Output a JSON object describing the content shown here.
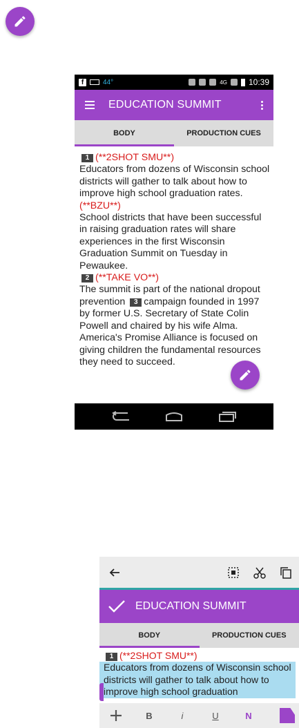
{
  "phone1": {
    "status": {
      "fb": "f",
      "temp": "44°",
      "network": "4G",
      "time": "10:39"
    },
    "title": "EDUCATION SUMMIT",
    "tabs": [
      {
        "label": "BODY"
      },
      {
        "label": "PRODUCTION CUES"
      }
    ],
    "script": {
      "n1": "1",
      "cue1": "(**2SHOT SMU**)",
      "p1": "Educators from dozens of Wisconsin school districts will gather to talk about how to improve high school graduation rates.",
      "cue2": "(**BZU**)",
      "p2": "School districts that have been successful in raising graduation rates will share experiences in the first Wisconsin Graduation Summit on Tuesday in Pewaukee.",
      "n2": "2",
      "cue3": "(**TAKE VO**)",
      "p3a": "The summit is part of the national dropout prevention",
      "n3": "3",
      "p3b": "campaign founded in 1997 by former U.S. Secretary of State Colin Powell and chaired by his wife Alma. America's Promise Alliance is focused on giving children the fundamental resources they need to succeed."
    }
  },
  "phone2": {
    "title": "EDUCATION SUMMIT",
    "tabs": [
      {
        "label": "BODY"
      },
      {
        "label": "PRODUCTION CUES"
      }
    ],
    "script": {
      "n1": "1",
      "cue1": "(**2SHOT SMU**)",
      "selected": "Educators from dozens of Wisconsin school districts will gather to talk about how to improve high school graduation"
    },
    "format": {
      "bold": "B",
      "italic": "i",
      "underline": "U",
      "note": "N"
    }
  },
  "colors": {
    "accent": "#9b45c8",
    "cue_red": "#d81b1b",
    "selection": "#aadcf0",
    "teal_line": "#2fa5a5"
  }
}
